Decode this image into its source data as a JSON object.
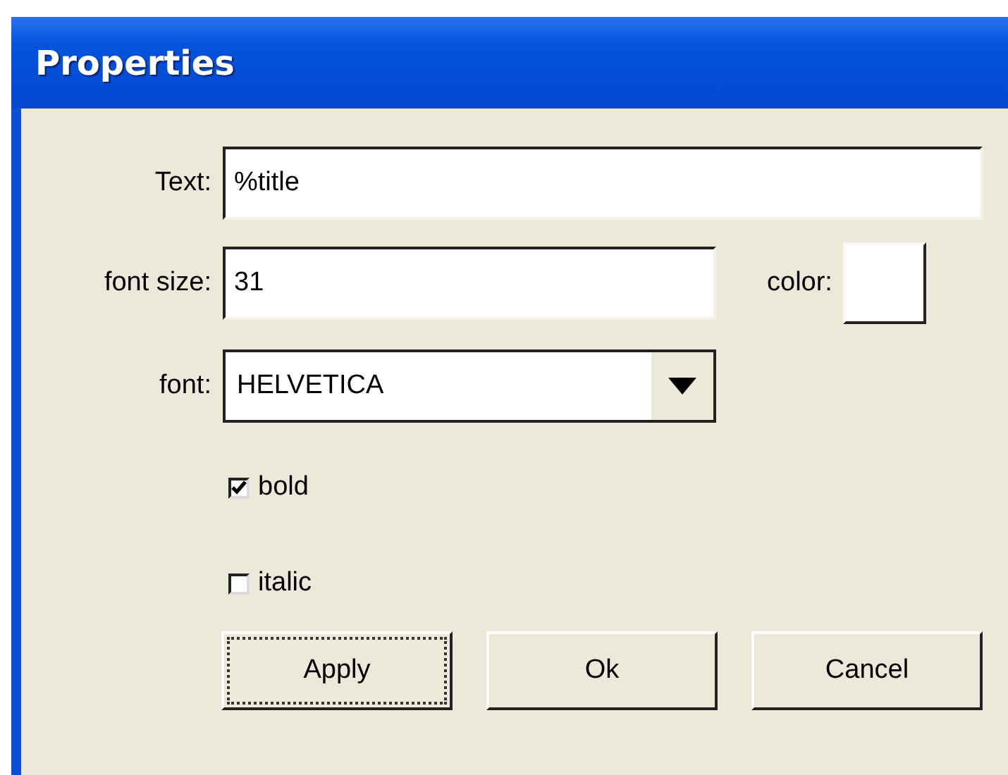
{
  "window": {
    "title": "Properties"
  },
  "fields": [
    {
      "label": "Text:",
      "value": "%title"
    },
    {
      "label": "font size:",
      "value": "31"
    }
  ],
  "color": {
    "label": "color:",
    "color": "#ffffff"
  },
  "font": {
    "label": "font:",
    "value": "HELVETICA"
  },
  "checkboxes": [
    {
      "label": "bold",
      "checked": true
    },
    {
      "label": "italic",
      "checked": false
    }
  ],
  "buttons": [
    {
      "label": "Apply",
      "focused": true
    },
    {
      "label": "Ok",
      "focused": false
    },
    {
      "label": "Cancel",
      "focused": false
    }
  ]
}
